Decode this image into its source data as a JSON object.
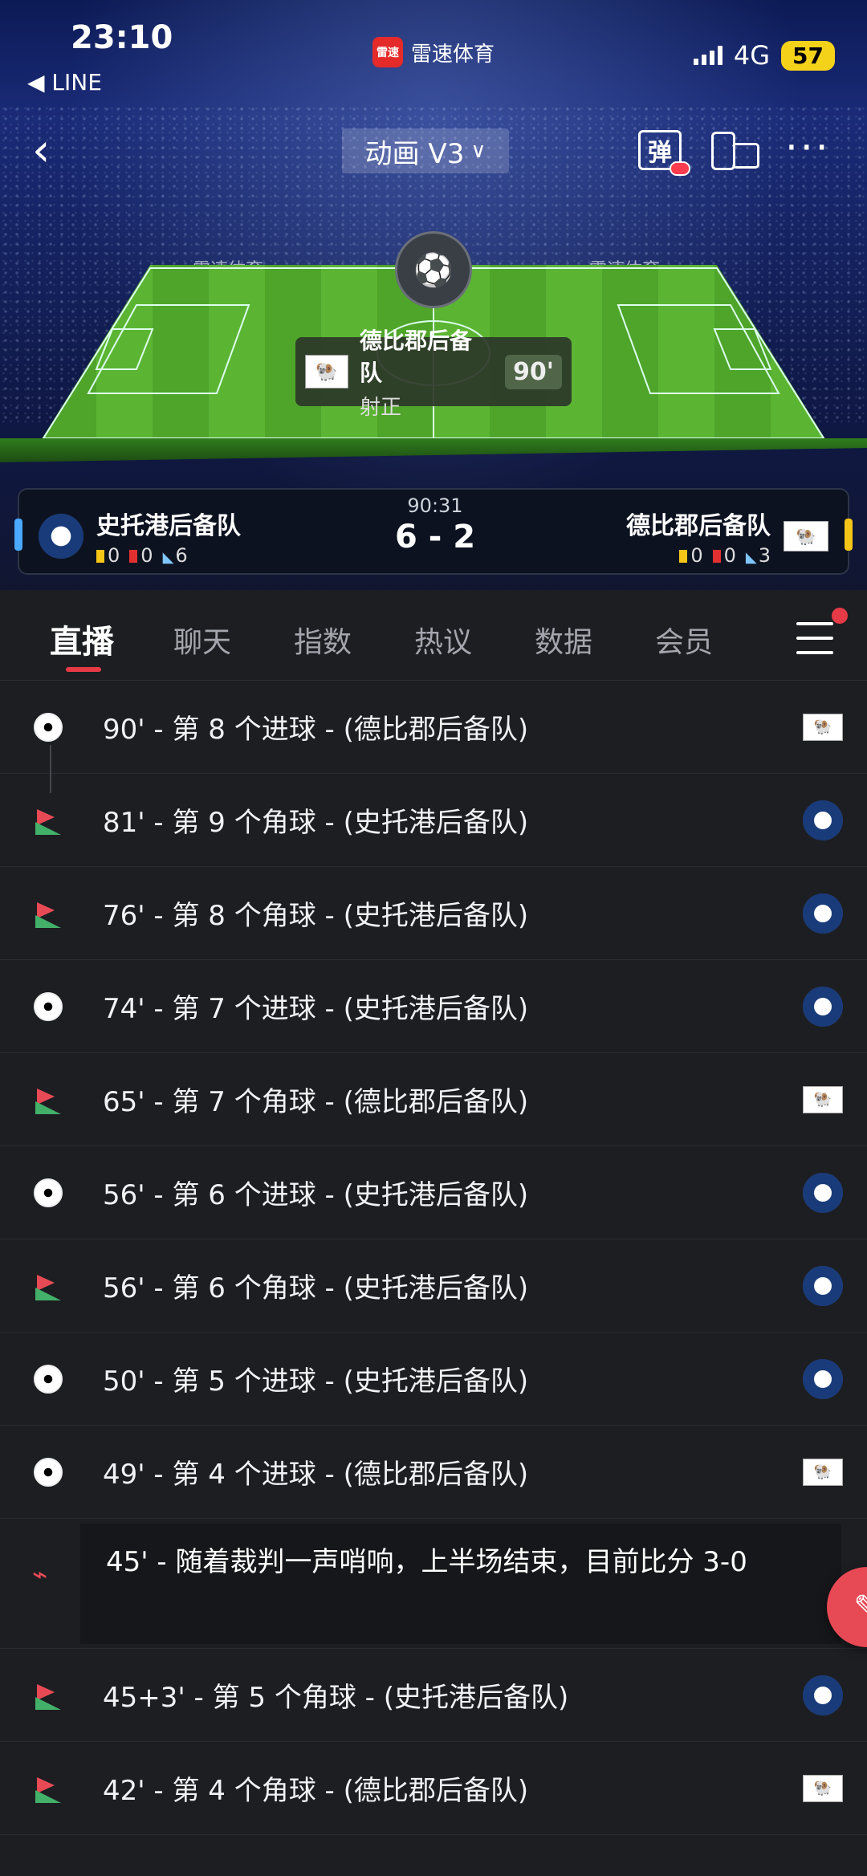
{
  "status_bar": {
    "time": "23:10",
    "back_app": "◀ LINE",
    "app_name": "雷速体育",
    "app_logo_text": "雷速",
    "network": "4G",
    "battery": "57"
  },
  "nav": {
    "mode_label": "动画 V3",
    "danmu_label": "弹"
  },
  "stadium": {
    "banner_text": "雷速体育",
    "event_team": "德比郡后备队",
    "event_type": "射正",
    "event_minute": "90'"
  },
  "scoreboard": {
    "home_team": "史托港后备队",
    "home_yellow": "0",
    "home_red": "0",
    "home_corners": "6",
    "away_team": "德比郡后备队",
    "away_yellow": "0",
    "away_red": "0",
    "away_corners": "3",
    "match_time": "90:31",
    "score": "6 - 2",
    "home_color": "#4aa8ff",
    "away_color": "#f5c518"
  },
  "tabs": [
    {
      "label": "直播",
      "active": true
    },
    {
      "label": "聊天"
    },
    {
      "label": "指数"
    },
    {
      "label": "热议"
    },
    {
      "label": "数据"
    },
    {
      "label": "会员"
    }
  ],
  "events": [
    {
      "icon": "ball-icon",
      "text": "90' - 第 8 个进球 - (德比郡后备队)",
      "team": "away"
    },
    {
      "icon": "corner-flag-icon",
      "text": "81' - 第 9 个角球 - (史托港后备队)",
      "team": "home"
    },
    {
      "icon": "corner-flag-icon",
      "text": "76' - 第 8 个角球 - (史托港后备队)",
      "team": "home"
    },
    {
      "icon": "ball-icon",
      "text": "74' - 第 7 个进球 - (史托港后备队)",
      "team": "home"
    },
    {
      "icon": "corner-flag-icon",
      "text": "65' - 第 7 个角球 - (德比郡后备队)",
      "team": "away"
    },
    {
      "icon": "ball-icon",
      "text": "56' - 第 6 个进球 - (史托港后备队)",
      "team": "home"
    },
    {
      "icon": "corner-flag-icon",
      "text": "56' - 第 6 个角球 - (史托港后备队)",
      "team": "home"
    },
    {
      "icon": "ball-icon",
      "text": "50' - 第 5 个进球 - (史托港后备队)",
      "team": "home"
    },
    {
      "icon": "ball-icon",
      "text": "49' - 第 4 个进球 - (德比郡后备队)",
      "team": "away"
    }
  ],
  "halftime": {
    "icon": "whistle-icon",
    "text": "45' - 随着裁判一声哨响，上半场结束，目前比分 3-0"
  },
  "events_after": [
    {
      "icon": "corner-flag-icon",
      "text": "45+3' - 第 5 个角球 - (史托港后备队)",
      "team": "home"
    },
    {
      "icon": "corner-flag-icon",
      "text": "42' - 第 4 个角球 - (德比郡后备队)",
      "team": "away"
    }
  ]
}
